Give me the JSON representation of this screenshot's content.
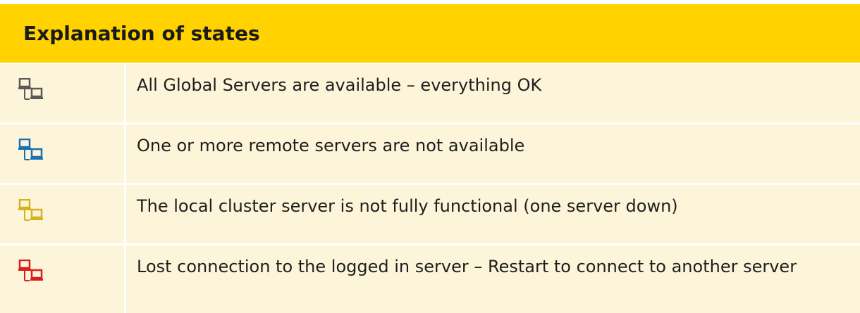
{
  "header": {
    "title": "Explanation of states"
  },
  "rows": [
    {
      "icon": "network-servers-gray-icon",
      "color": "#5a5a5a",
      "text": "All Global Servers are available – everything OK"
    },
    {
      "icon": "network-servers-blue-icon",
      "color": "#1b6fb3",
      "text": "One or more remote servers are not available"
    },
    {
      "icon": "network-servers-yellow-icon",
      "color": "#d8b21e",
      "text": "The local cluster server is not fully functional (one server down)"
    },
    {
      "icon": "network-servers-red-icon",
      "color": "#d81e1e",
      "text": "Lost connection to the logged in server – Restart to connect to another server"
    }
  ]
}
